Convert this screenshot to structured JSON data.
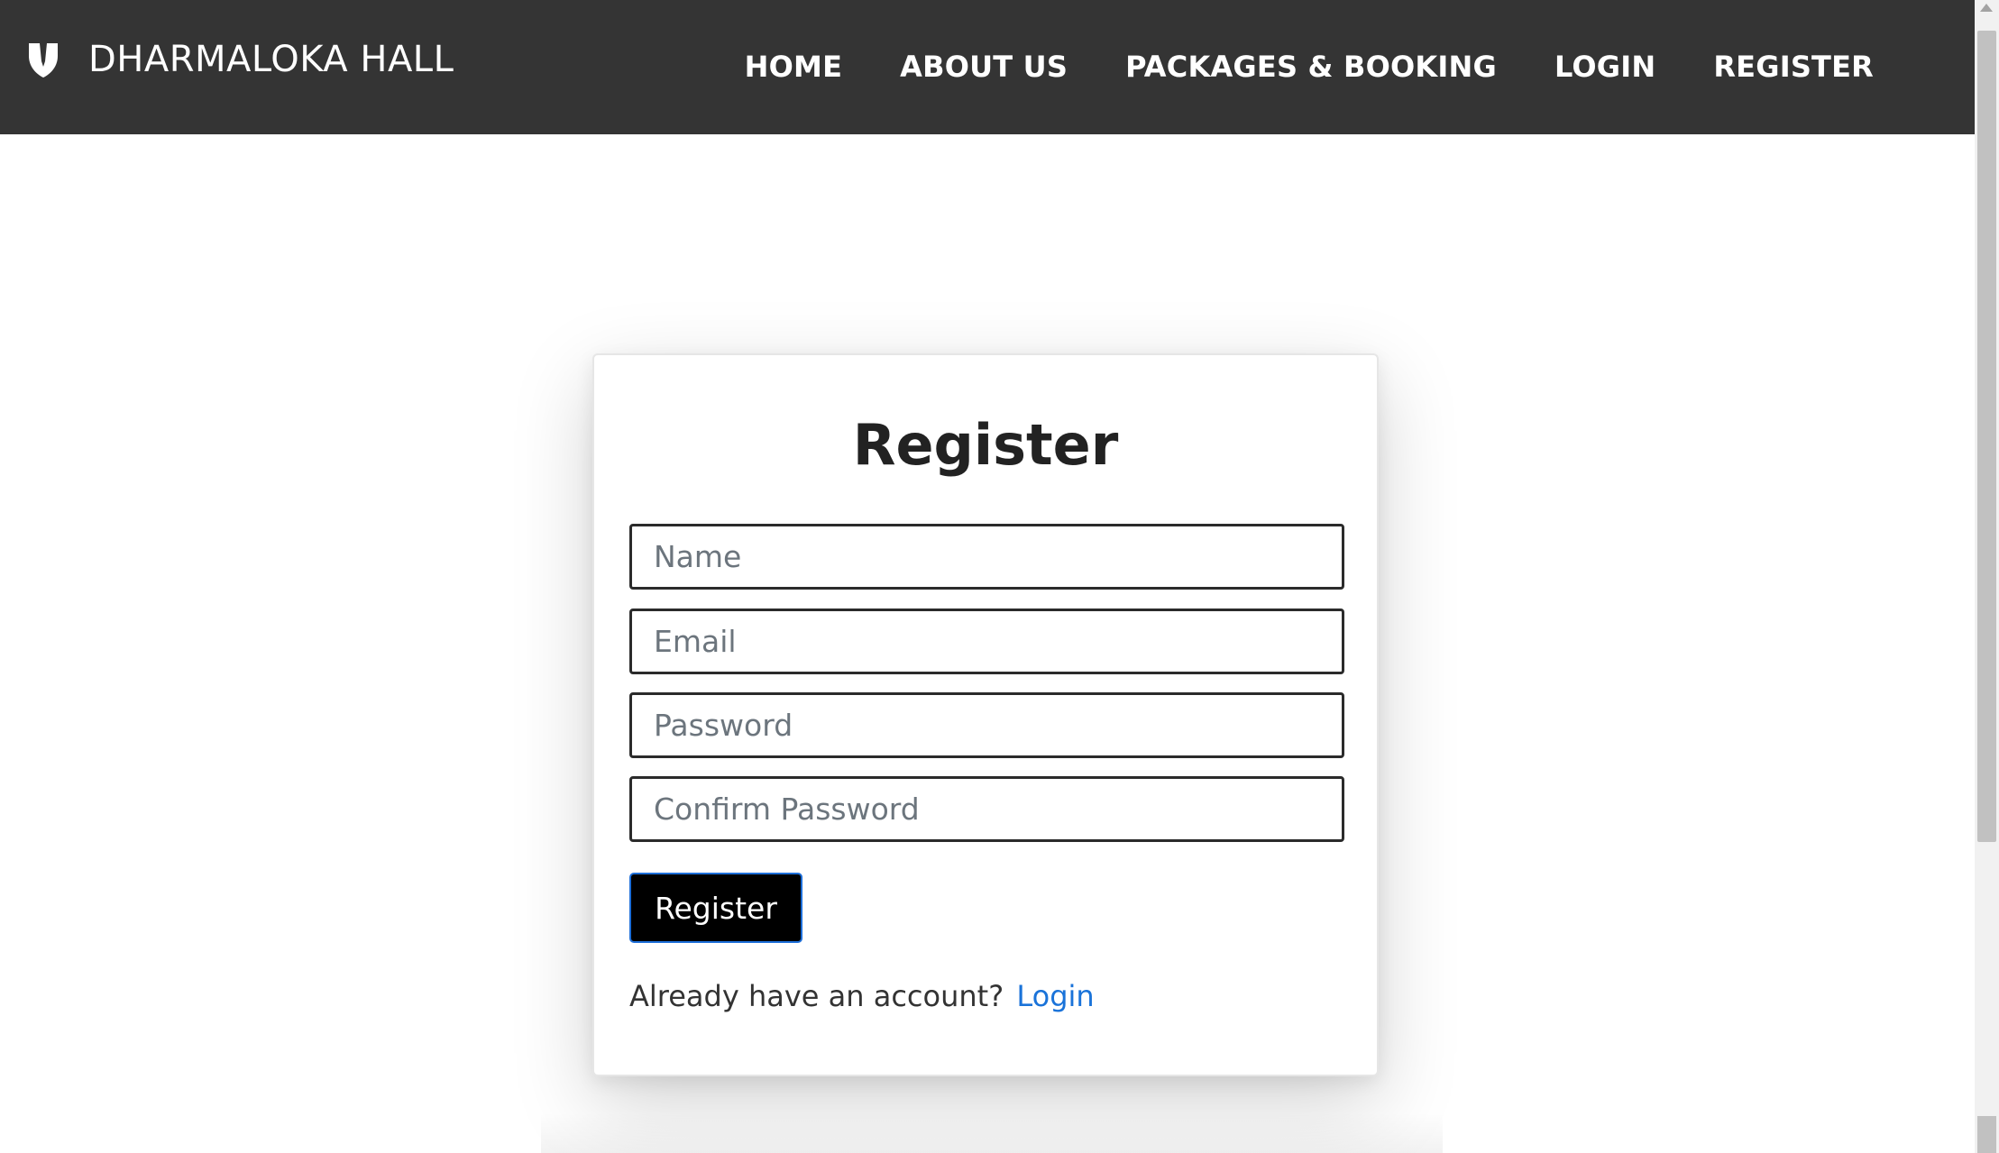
{
  "brand": {
    "name": "DHARMALOKA HALL",
    "icon": "shield-logo-icon"
  },
  "nav": {
    "items": [
      {
        "label": "HOME"
      },
      {
        "label": "ABOUT US"
      },
      {
        "label": "PACKAGES & BOOKING"
      },
      {
        "label": "LOGIN"
      },
      {
        "label": "REGISTER"
      }
    ]
  },
  "form": {
    "title": "Register",
    "fields": {
      "name": {
        "placeholder": "Name",
        "value": ""
      },
      "email": {
        "placeholder": "Email",
        "value": ""
      },
      "password": {
        "placeholder": "Password",
        "value": ""
      },
      "confirm_password": {
        "placeholder": "Confirm Password",
        "value": ""
      }
    },
    "submit_label": "Register",
    "login_prompt": "Already have an account?",
    "login_link": "Login"
  },
  "colors": {
    "navbar": "#343434",
    "link": "#1a73d9",
    "button": "#000000"
  }
}
